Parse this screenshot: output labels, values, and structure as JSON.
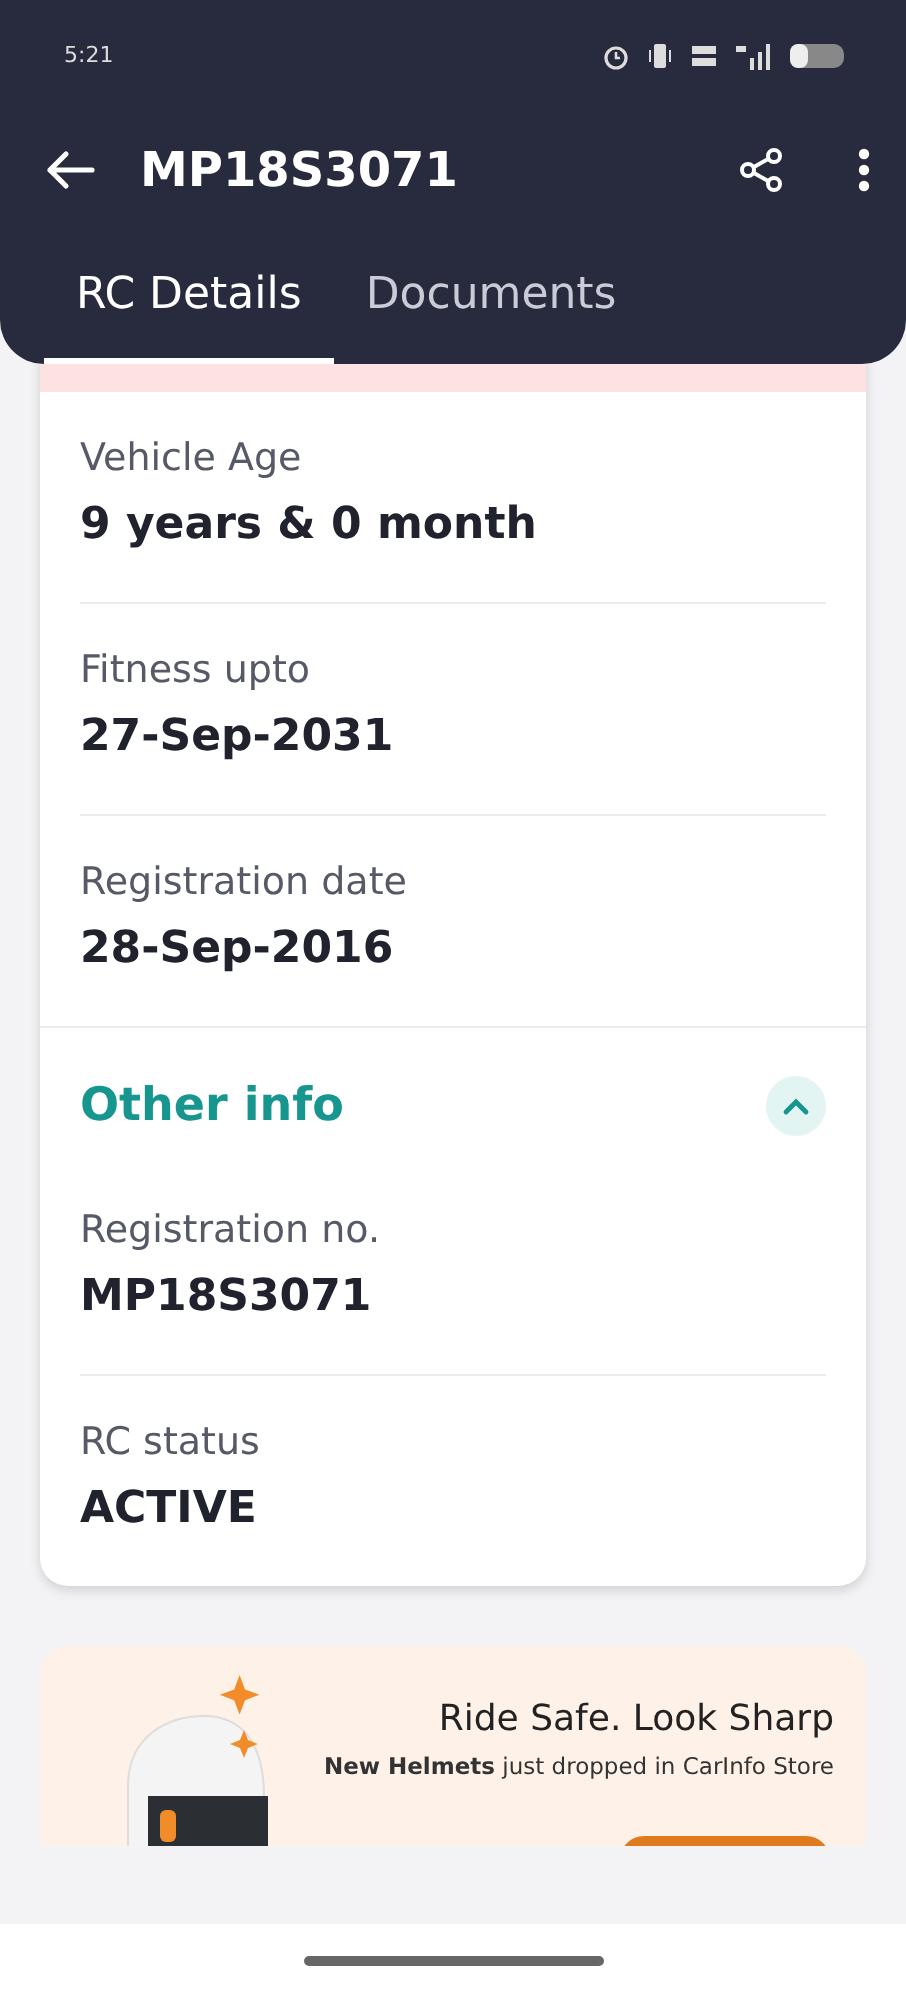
{
  "status_bar": {
    "time": "5:21"
  },
  "app_bar": {
    "title": "MP18S3071"
  },
  "tabs": [
    {
      "label": "RC Details",
      "selected": true
    },
    {
      "label": "Documents",
      "selected": false
    }
  ],
  "details": [
    {
      "label": "Vehicle Age",
      "value": "9 years & 0 month"
    },
    {
      "label": "Fitness upto",
      "value": "27-Sep-2031"
    },
    {
      "label": "Registration date",
      "value": "28-Sep-2016"
    }
  ],
  "other_info": {
    "title": "Other info",
    "expanded": true,
    "items": [
      {
        "label": "Registration no.",
        "value": "MP18S3071"
      },
      {
        "label": "RC status",
        "value": "ACTIVE"
      }
    ]
  },
  "banner": {
    "title": "Ride Safe. Look Sharp",
    "subtitle": "**New Helmets** just dropped in CarInfo Store"
  }
}
